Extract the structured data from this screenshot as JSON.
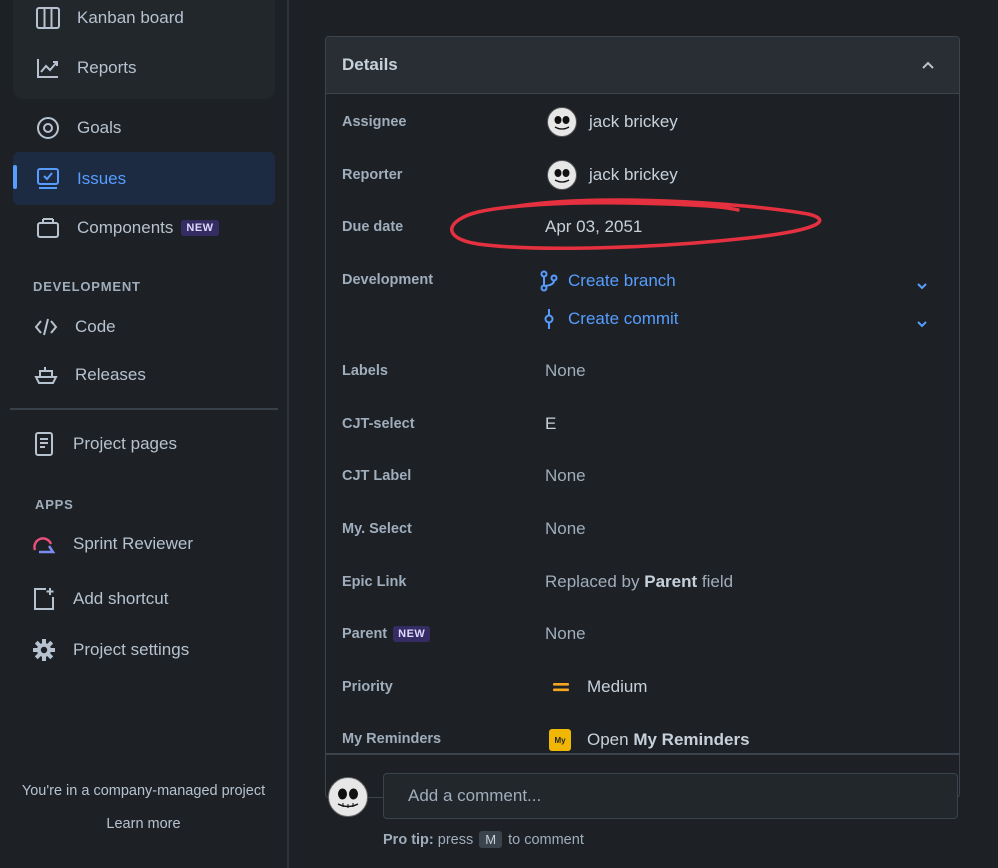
{
  "sidebar": {
    "group_items": [
      {
        "label": "Kanban board",
        "icon": "columns-icon"
      },
      {
        "label": "Reports",
        "icon": "chart-line-icon"
      }
    ],
    "items": [
      {
        "label": "Goals",
        "icon": "target-icon"
      },
      {
        "label": "Issues",
        "icon": "issues-icon",
        "active": true
      },
      {
        "label": "Components",
        "icon": "components-icon",
        "badge": "NEW"
      }
    ],
    "development_heading": "DEVELOPMENT",
    "development_items": [
      {
        "label": "Code",
        "icon": "code-icon"
      },
      {
        "label": "Releases",
        "icon": "ship-icon"
      }
    ],
    "project_pages": "Project pages",
    "apps_heading": "APPS",
    "apps_items": [
      {
        "label": "Sprint Reviewer",
        "icon": "sprint-reviewer-icon"
      },
      {
        "label": "Add shortcut",
        "icon": "add-shortcut-icon"
      },
      {
        "label": "Project settings",
        "icon": "gear-icon"
      }
    ],
    "footer_text": "You're in a company-managed project",
    "learn_more": "Learn more"
  },
  "details": {
    "title": "Details",
    "rows": {
      "assignee": {
        "label": "Assignee",
        "value": "jack brickey"
      },
      "reporter": {
        "label": "Reporter",
        "value": "jack brickey"
      },
      "due_date": {
        "label": "Due date",
        "value": "Apr 03, 2051"
      },
      "development": {
        "label": "Development",
        "create_branch": "Create branch",
        "create_commit": "Create commit"
      },
      "labels": {
        "label": "Labels",
        "value": "None"
      },
      "cjt_select": {
        "label": "CJT-select",
        "value": "E"
      },
      "cjt_label": {
        "label": "CJT Label",
        "value": "None"
      },
      "my_select": {
        "label": "My. Select",
        "value": "None"
      },
      "epic_link": {
        "label": "Epic Link",
        "value_prefix": "Replaced by",
        "value_bold": "Parent",
        "value_suffix": "field"
      },
      "parent": {
        "label": "Parent",
        "badge": "NEW",
        "value": "None"
      },
      "priority": {
        "label": "Priority",
        "value": "Medium"
      },
      "my_reminders": {
        "label": "My Reminders",
        "value_prefix": "Open",
        "value_bold": "My Reminders",
        "icon_text": "My"
      }
    }
  },
  "comment": {
    "placeholder": "Add a comment...",
    "pro_tip_label": "Pro tip:",
    "pro_tip_press": "press",
    "pro_tip_key": "M",
    "pro_tip_suffix": "to comment"
  },
  "colors": {
    "accent": "#579dff",
    "priority_medium": "#f5a623",
    "annotation_red": "#e5313f"
  }
}
